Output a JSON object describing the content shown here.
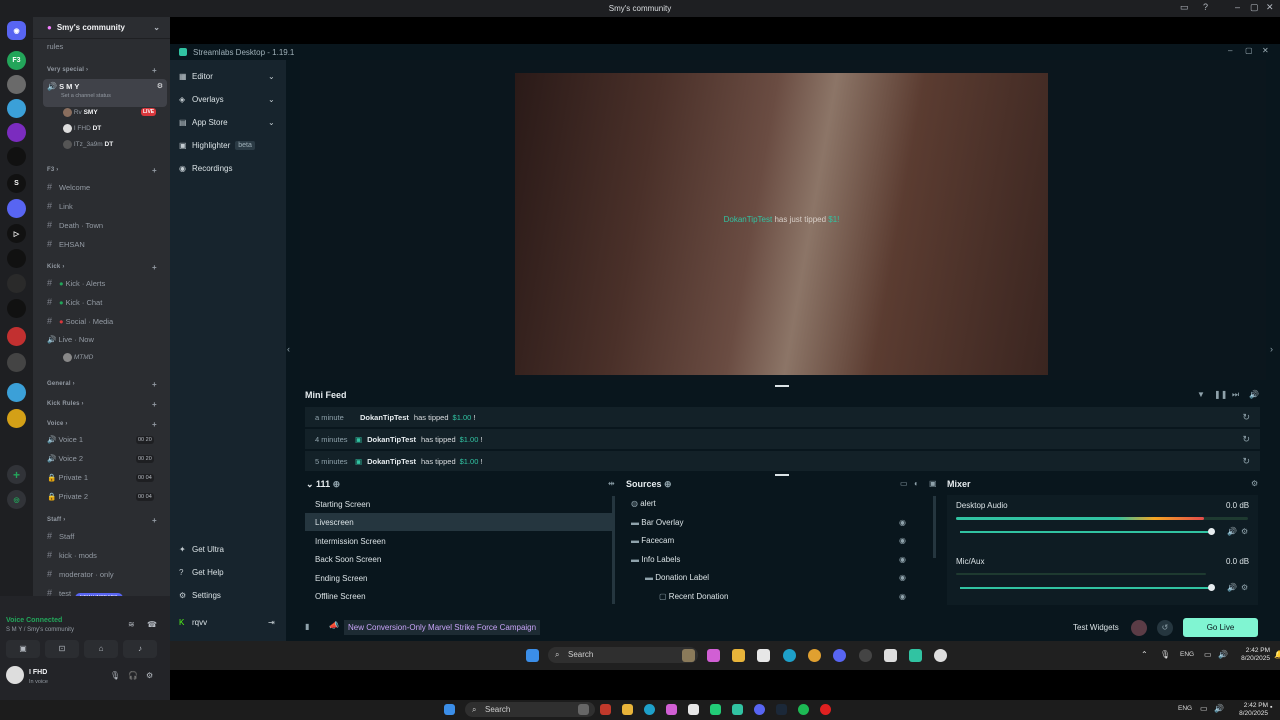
{
  "discord": {
    "window_title": "Smy's community",
    "server_name": "Smy's community",
    "top_channel": "rules",
    "categories": {
      "very_special": "Very special",
      "f3": "F3",
      "kick": "Kick",
      "general": "General",
      "kick_rules": "Kick Rules",
      "voice": "Voice",
      "staff": "Staff"
    },
    "smy_channel": "S M Y",
    "smy_status": "Set a channel status",
    "smy_members": [
      "Rv",
      "I FHD",
      "ITz_3a9m"
    ],
    "smy_member_tags": [
      "SMY",
      "DT",
      "DT"
    ],
    "live_label": "LIVE",
    "f3_channels": [
      "Welcome",
      "Link",
      "Death · Town",
      "EHSAN"
    ],
    "kick_channels": [
      "Kick · Alerts",
      "Kick · Chat",
      "Social · Media",
      "Live · Now"
    ],
    "kick_member": "MTMD",
    "voice_channels": [
      "Voice 1",
      "Voice 2",
      "Private 1",
      "Private 2"
    ],
    "voice_counts": [
      "00 20",
      "00 20",
      "00 04",
      "00 04"
    ],
    "staff_channels": [
      "Staff",
      "kick · mods",
      "moderator · only",
      "test"
    ],
    "new_unreads": "NEW UNREADS",
    "voice_connected": "Voice Connected",
    "voice_location": "S M Y / Smy's community",
    "user_name": "I FHD",
    "user_status": "In voice"
  },
  "streamlabs": {
    "title": "Streamlabs Desktop - 1.19.1",
    "nav": {
      "editor": "Editor",
      "overlays": "Overlays",
      "app_store": "App Store",
      "highlighter": "Highlighter",
      "beta": "beta",
      "recordings": "Recordings",
      "get_ultra": "Get Ultra",
      "get_help": "Get Help",
      "settings": "Settings",
      "user": "rqvv"
    },
    "preview_tip": {
      "name": "DokanTipTest",
      "text": "has just tipped",
      "amount": "$1!"
    },
    "mini_feed": {
      "title": "Mini Feed",
      "rows": [
        {
          "time": "a minute",
          "user": "DokanTipTest",
          "action": "has tipped",
          "amount": "$1.00",
          "msg": "!"
        },
        {
          "time": "4 minutes",
          "user": "DokanTipTest",
          "action": "has tipped",
          "amount": "$1.00",
          "msg": "!"
        },
        {
          "time": "5 minutes",
          "user": "DokanTipTest",
          "action": "has tipped",
          "amount": "$1.00",
          "msg": "!"
        }
      ]
    },
    "scenes": {
      "title": "111",
      "items": [
        "Starting Screen",
        "Livescreen",
        "Intermission Screen",
        "Back Soon Screen",
        "Ending Screen",
        "Offline Screen"
      ],
      "selected": "Livescreen"
    },
    "sources": {
      "title": "Sources",
      "items": [
        "alert",
        "Bar Overlay",
        "Facecam",
        "Info Labels",
        "Donation Label",
        "Recent Donation"
      ]
    },
    "mixer": {
      "title": "Mixer",
      "channels": [
        {
          "name": "Desktop Audio",
          "db": "0.0 dB",
          "level": 0.85
        },
        {
          "name": "Mic/Aux",
          "db": "0.0 dB",
          "level": 0.0
        }
      ]
    },
    "footer": {
      "campaign": "New Conversion-Only Marvel Strike Force Campaign",
      "test_widgets": "Test Widgets",
      "go_live": "Go Live"
    }
  },
  "taskbar": {
    "search": "Search",
    "lang": "ENG",
    "time": "2:42 PM",
    "date": "8/20/2025"
  }
}
